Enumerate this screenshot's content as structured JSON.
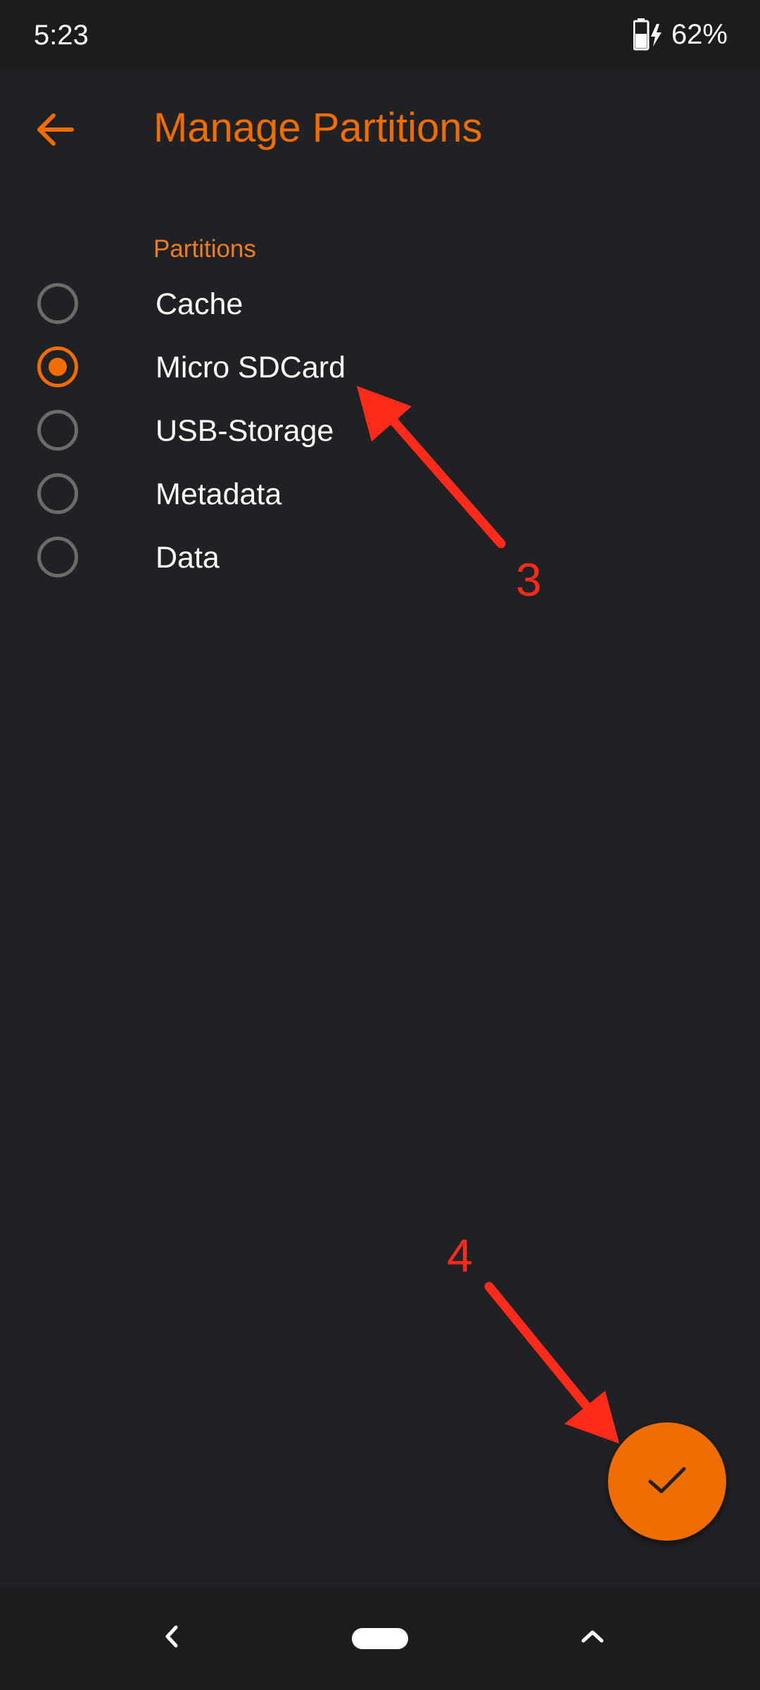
{
  "status_bar": {
    "time": "5:23",
    "battery_percent": "62%",
    "battery_icon": "battery-charging-icon"
  },
  "app_bar": {
    "back_icon": "arrow-left-icon",
    "title": "Manage Partitions"
  },
  "section": {
    "title": "Partitions"
  },
  "partitions": [
    {
      "label": "Cache",
      "selected": false
    },
    {
      "label": "Micro SDCard",
      "selected": true
    },
    {
      "label": "USB-Storage",
      "selected": false
    },
    {
      "label": "Metadata",
      "selected": false
    },
    {
      "label": "Data",
      "selected": false
    }
  ],
  "annotations": [
    {
      "number": "3"
    },
    {
      "number": "4"
    }
  ],
  "fab": {
    "icon": "check-icon"
  },
  "nav_bar": {
    "back_icon": "chevron-left-icon",
    "home_icon": "home-pill-icon",
    "recents_icon": "chevron-up-icon"
  },
  "colors": {
    "background": "#202124",
    "accent": "#ef6c00",
    "annotation": "#ff2a1a",
    "text": "#ffffff"
  }
}
